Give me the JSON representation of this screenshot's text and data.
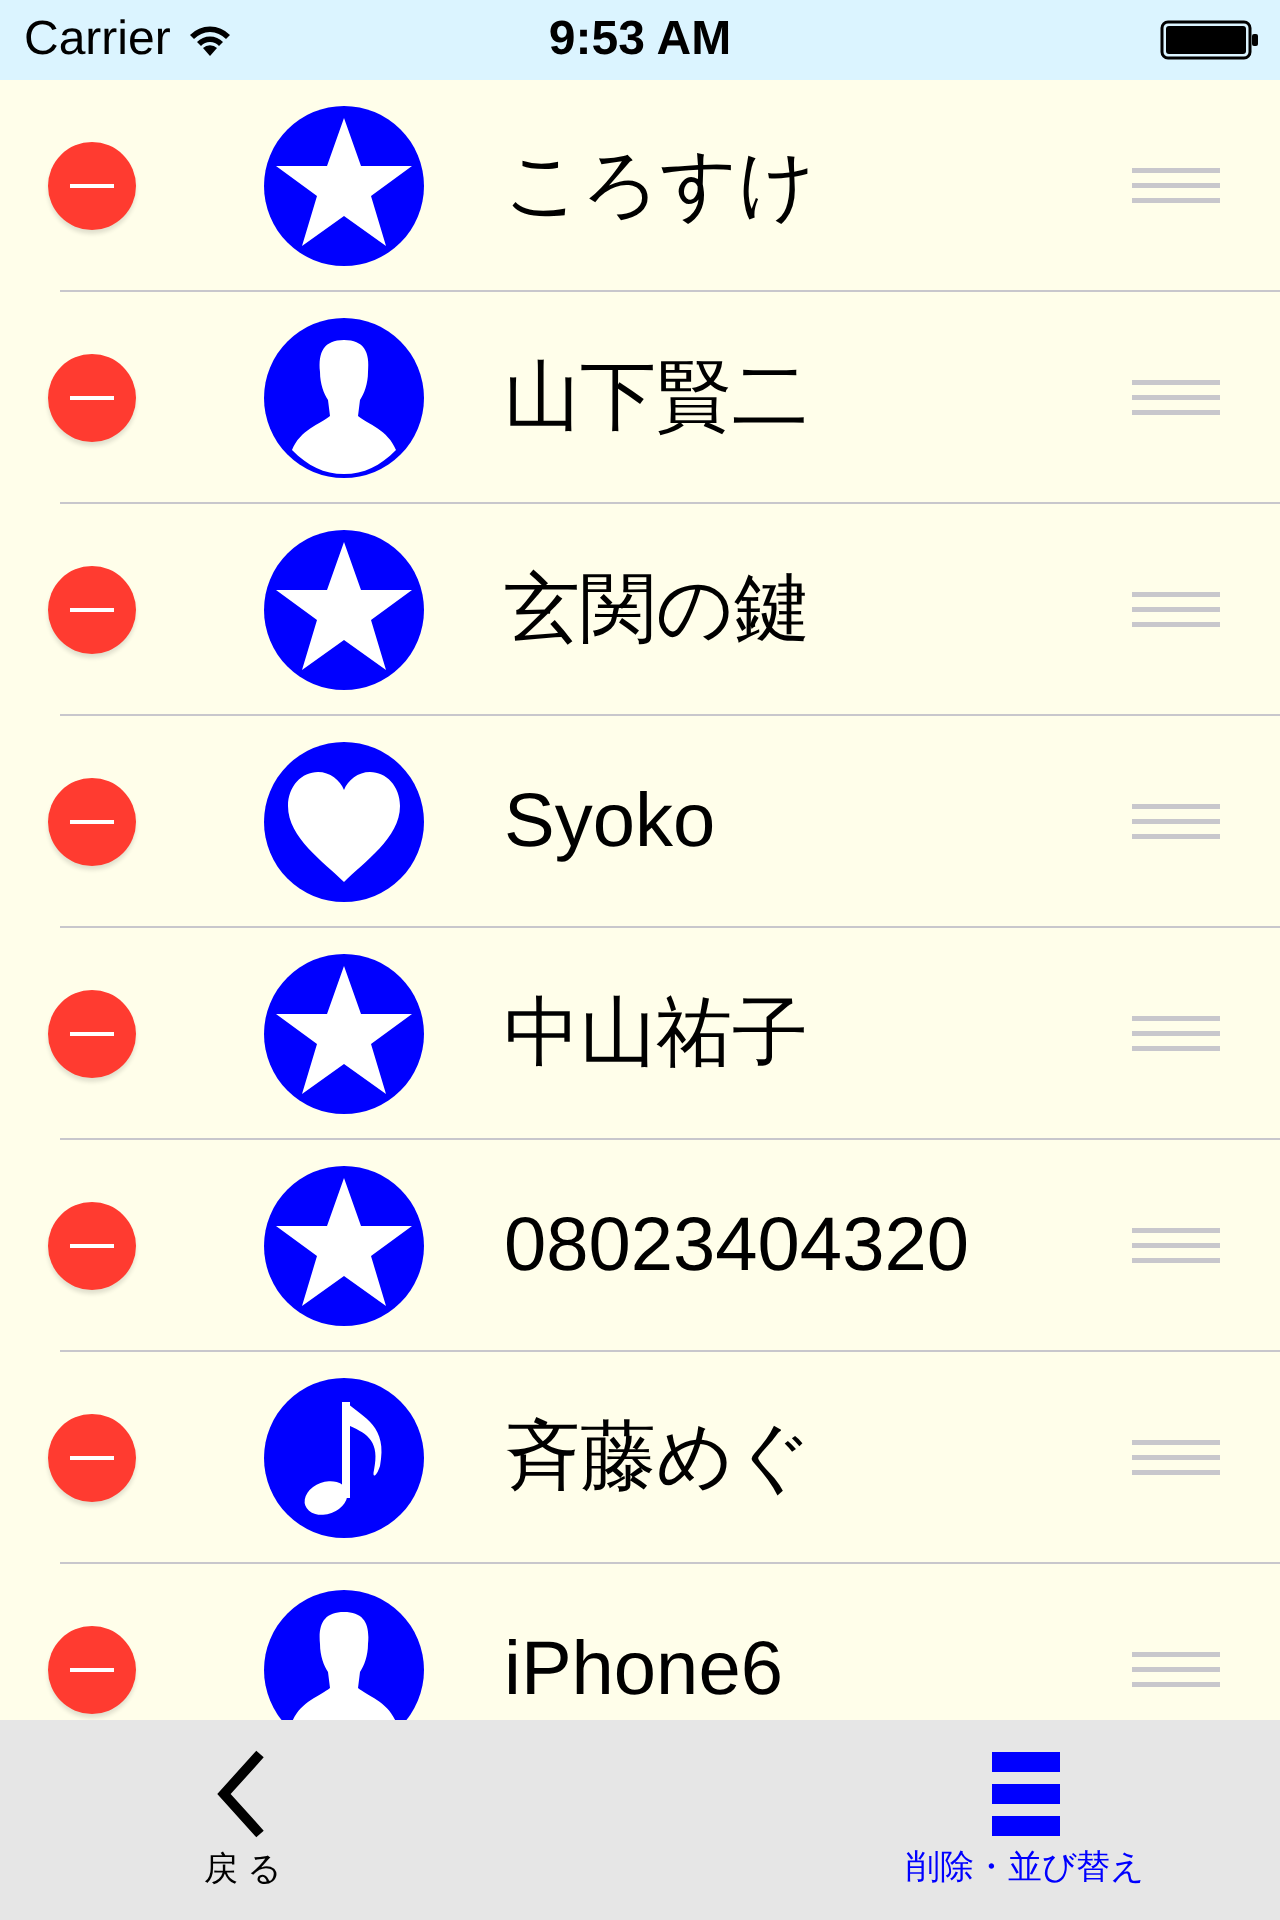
{
  "status_bar": {
    "carrier": "Carrier",
    "time": "9:53 AM"
  },
  "rows": [
    {
      "kind": "star",
      "name": "ころすけ"
    },
    {
      "kind": "person",
      "name": "山下賢二"
    },
    {
      "kind": "star",
      "name": "玄関の鍵"
    },
    {
      "kind": "heart",
      "name": "Syoko"
    },
    {
      "kind": "star",
      "name": "中山祐子"
    },
    {
      "kind": "star",
      "name": "08023404320"
    },
    {
      "kind": "note",
      "name": "斉藤めぐ"
    },
    {
      "kind": "person",
      "name": "iPhone6"
    }
  ],
  "toolbar": {
    "back": "戻 る",
    "edit": "削除・並び替え"
  }
}
